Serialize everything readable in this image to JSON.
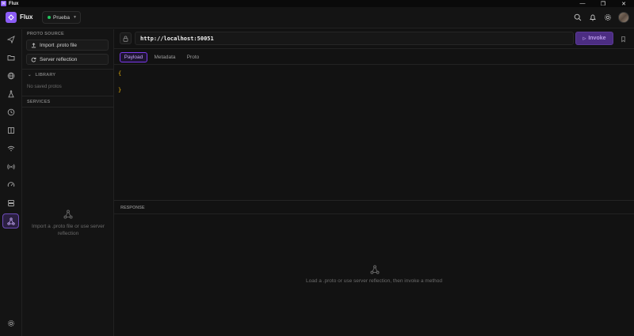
{
  "os": {
    "title": "Flux",
    "controls": [
      "minimize-icon",
      "restore-icon",
      "close-icon"
    ]
  },
  "header": {
    "app_name": "Flux",
    "workspace": "Prueba",
    "workspace_status_color": "#22c55e",
    "icons": [
      "search-icon",
      "bell-icon",
      "gear-icon",
      "avatar"
    ]
  },
  "rail": {
    "items": [
      "send-icon",
      "folder-icon",
      "globe-icon",
      "flask-icon",
      "clock-icon",
      "book-icon",
      "wifi-icon",
      "broadcast-icon",
      "gauge-icon",
      "server-icon",
      "grpc-icon"
    ],
    "active": "grpc-icon",
    "bottom": "settings-icon"
  },
  "side": {
    "proto_source_title": "PROTO SOURCE",
    "import_label": "Import .proto file",
    "reflection_label": "Server reflection",
    "library_title": "LIBRARY",
    "library_empty": "No saved protos",
    "services_title": "SERVICES",
    "services_empty_line1": "Import a .proto file or use server",
    "services_empty_line2": "reflection"
  },
  "main": {
    "url": "http://localhost:50051",
    "invoke_label": "Invoke",
    "tabs": [
      {
        "label": "Payload",
        "active": true
      },
      {
        "label": "Metadata",
        "active": false
      },
      {
        "label": "Proto",
        "active": false
      }
    ],
    "editor_lines": [
      "{",
      "}"
    ],
    "response_title": "RESPONSE",
    "response_empty": "Load a .proto or use server reflection, then invoke a method"
  },
  "colors": {
    "accent": "#8b5cf6",
    "invoke_bg": "#4c2d82",
    "json_brace": "#eab308",
    "background": "#121212"
  }
}
